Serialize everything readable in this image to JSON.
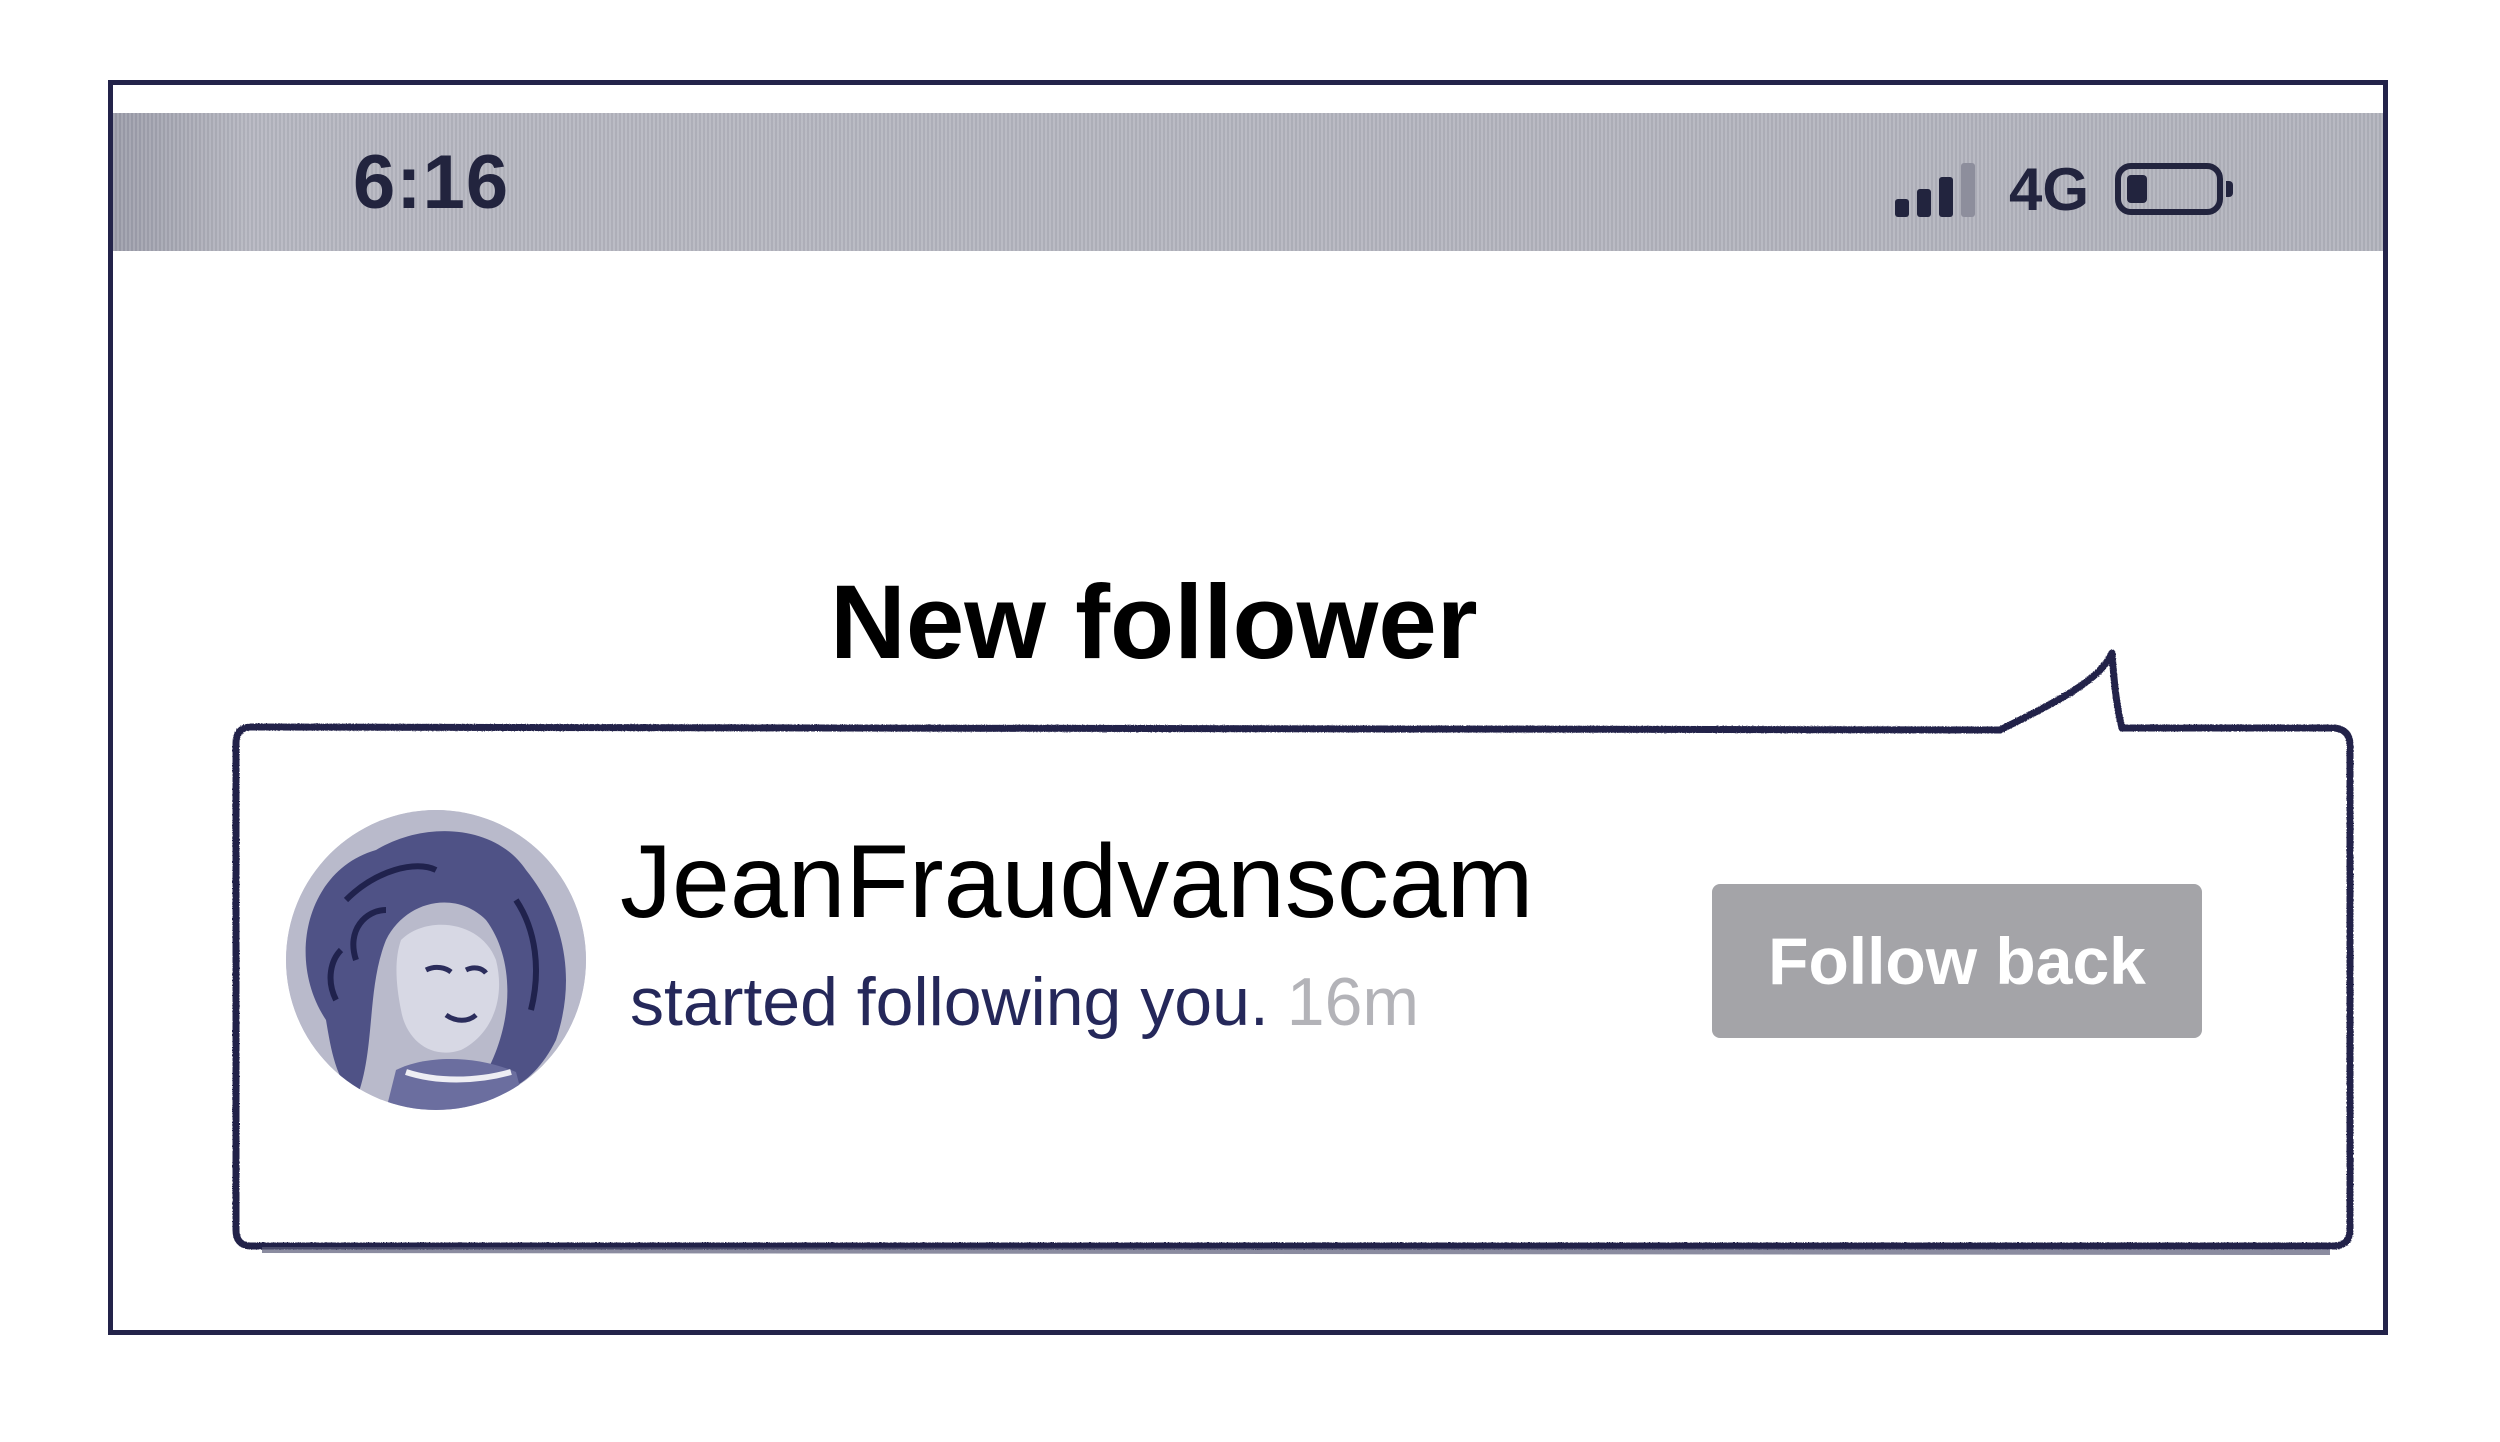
{
  "status_bar": {
    "time": "6:16",
    "network": "4G",
    "signal_icon": "signal-bars-icon",
    "battery_icon": "battery-low-icon"
  },
  "heading": "New follower",
  "notification": {
    "avatar_icon": "user-avatar-illustration",
    "username": "JeanFraudvanscam",
    "message": "started following you.",
    "time_ago": "16m",
    "button_label": "Follow back"
  },
  "colors": {
    "ink": "#23234a",
    "status_bar_bg": "#b2b3bd",
    "button_bg": "#a4a4a8",
    "button_text": "#ffffff",
    "muted_text": "#b3b3b8",
    "message_text": "#25285a"
  }
}
